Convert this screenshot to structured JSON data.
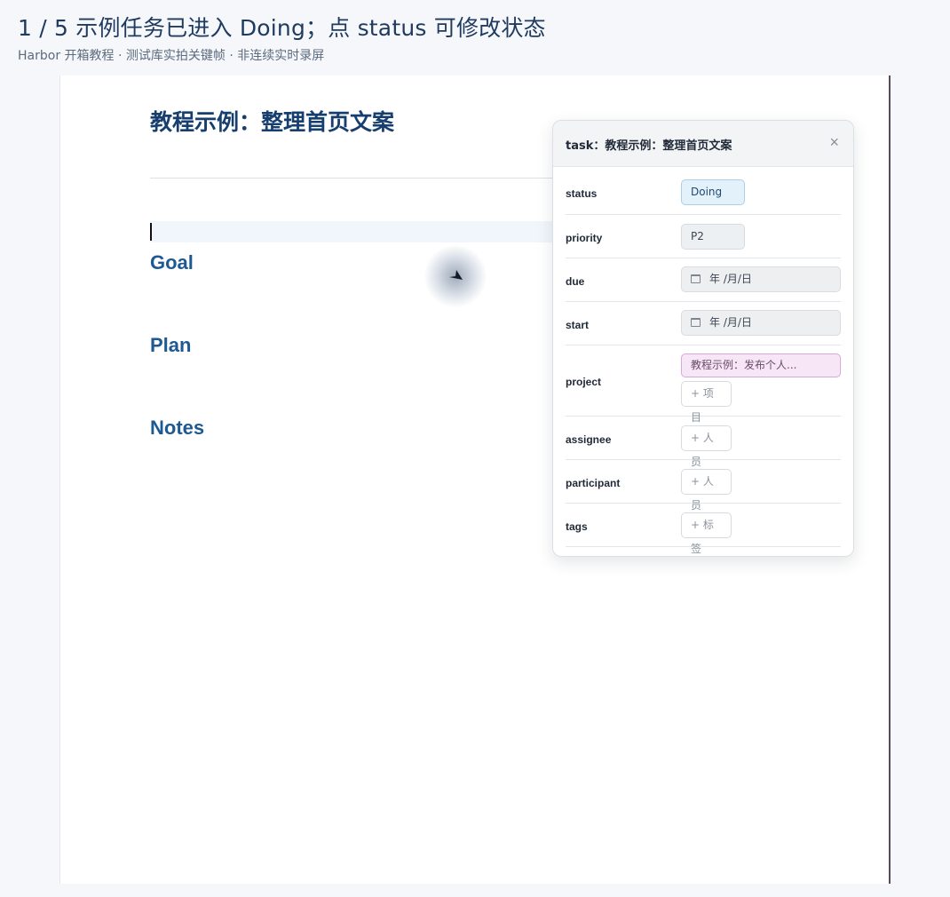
{
  "caption": {
    "title": "1 / 5  示例任务已进入 Doing；点 status 可修改状态",
    "subtitle": "Harbor 开箱教程 · 测试库实拍关键帧 · 非连续实时录屏"
  },
  "document": {
    "title": "教程示例：整理首页文案",
    "headings": [
      "Goal",
      "Plan",
      "Notes"
    ]
  },
  "panel": {
    "title": "task：教程示例：整理首页文案",
    "close_icon": "×",
    "props": {
      "status": {
        "label": "status",
        "value": "Doing"
      },
      "priority": {
        "label": "priority",
        "value": "P2"
      },
      "due": {
        "label": "due",
        "value": "年 /月/日"
      },
      "start": {
        "label": "start",
        "value": "年 /月/日"
      },
      "project": {
        "label": "project",
        "value": "教程示例：发布个人...",
        "add": "+ 项目"
      },
      "assignee": {
        "label": "assignee",
        "add": "+ 人员"
      },
      "participant": {
        "label": "participant",
        "add": "+ 人员"
      },
      "tags": {
        "label": "tags",
        "add": "+ 标签"
      }
    }
  },
  "colors": {
    "heading": "#1d5a94",
    "status_chip": "#e3f1fb",
    "project_chip": "#f6e6f6"
  },
  "icons": [
    "close-icon",
    "calendar-icon",
    "pointer-icon"
  ]
}
